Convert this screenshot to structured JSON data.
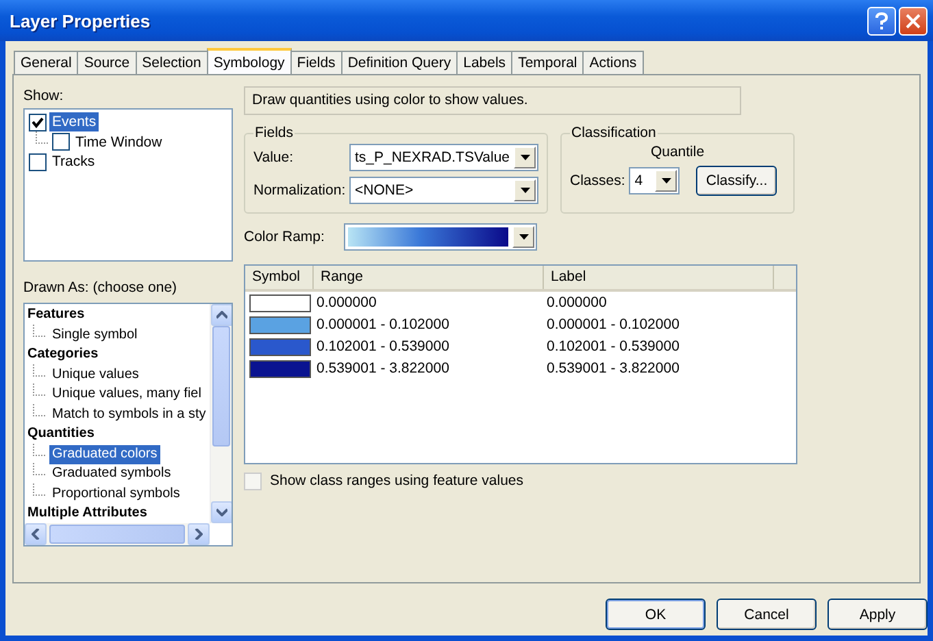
{
  "window": {
    "title": "Layer Properties"
  },
  "tabs": [
    {
      "label": "General",
      "selected": false
    },
    {
      "label": "Source",
      "selected": false
    },
    {
      "label": "Selection",
      "selected": false
    },
    {
      "label": "Symbology",
      "selected": true
    },
    {
      "label": "Fields",
      "selected": false
    },
    {
      "label": "Definition Query",
      "selected": false
    },
    {
      "label": "Labels",
      "selected": false
    },
    {
      "label": "Temporal",
      "selected": false
    },
    {
      "label": "Actions",
      "selected": false
    }
  ],
  "show": {
    "label": "Show:",
    "items": [
      {
        "label": "Events",
        "checked": true,
        "selected": true,
        "children": [
          {
            "label": "Time Window",
            "checked": false,
            "selected": false
          }
        ]
      },
      {
        "label": "Tracks",
        "checked": false,
        "selected": false
      }
    ]
  },
  "drawn_as": {
    "label": "Drawn As: (choose one)",
    "groups": [
      {
        "label": "Features",
        "children": [
          {
            "label": "Single symbol",
            "selected": false
          }
        ]
      },
      {
        "label": "Categories",
        "children": [
          {
            "label": "Unique values",
            "selected": false
          },
          {
            "label": "Unique values, many fiel",
            "selected": false
          },
          {
            "label": "Match to symbols in a sty",
            "selected": false
          }
        ]
      },
      {
        "label": "Quantities",
        "children": [
          {
            "label": "Graduated colors",
            "selected": true
          },
          {
            "label": "Graduated symbols",
            "selected": false
          },
          {
            "label": "Proportional symbols",
            "selected": false
          }
        ]
      },
      {
        "label": "Multiple Attributes"
      }
    ]
  },
  "description": "Draw quantities using color to show values.",
  "fields": {
    "title": "Fields",
    "value": {
      "label": "Value:",
      "value": "ts_P_NEXRAD.TSValue"
    },
    "normalization": {
      "label": "Normalization:",
      "value": "<NONE>"
    }
  },
  "classification": {
    "title": "Classification",
    "method": "Quantile",
    "classes": {
      "label": "Classes:",
      "value": "4"
    },
    "button": "Classify..."
  },
  "color_ramp": {
    "label": "Color Ramp:"
  },
  "table": {
    "columns": [
      "Symbol",
      "Range",
      "Label"
    ],
    "rows": [
      {
        "color": "#ffffff",
        "range": "0.000000",
        "label": "0.000000"
      },
      {
        "color": "#5aa2e2",
        "range": "0.000001 - 0.102000",
        "label": "0.000001 - 0.102000"
      },
      {
        "color": "#2a58cc",
        "range": "0.102001 - 0.539000",
        "label": "0.102001 - 0.539000"
      },
      {
        "color": "#0a1390",
        "range": "0.539001 - 3.822000",
        "label": "0.539001 - 3.822000"
      }
    ]
  },
  "show_class_ranges": {
    "label": "Show class ranges using feature values",
    "checked": false
  },
  "buttons": [
    "OK",
    "Cancel",
    "Apply"
  ]
}
